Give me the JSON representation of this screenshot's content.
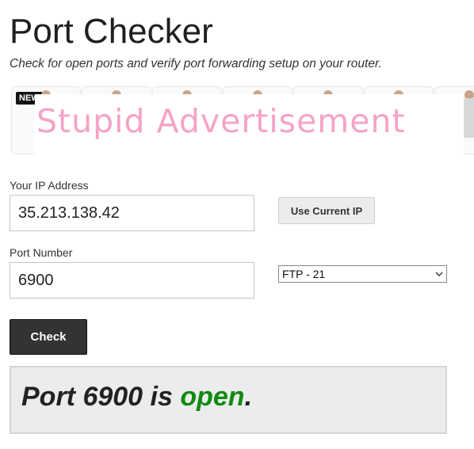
{
  "header": {
    "title": "Port Checker",
    "subtitle": "Check for open ports and verify port forwarding setup on your router."
  },
  "advertisement": {
    "badge": "NEW",
    "text": "Stupid Advertisement"
  },
  "form": {
    "ip_label": "Your IP Address",
    "ip_value": "35.213.138.42",
    "use_current_ip_label": "Use Current IP",
    "port_label": "Port Number",
    "port_value": "6900",
    "service_selected": "FTP - 21",
    "check_label": "Check"
  },
  "result": {
    "prefix": "Port 6900 is ",
    "status": "open",
    "suffix": ".",
    "status_color": "#118a11"
  }
}
